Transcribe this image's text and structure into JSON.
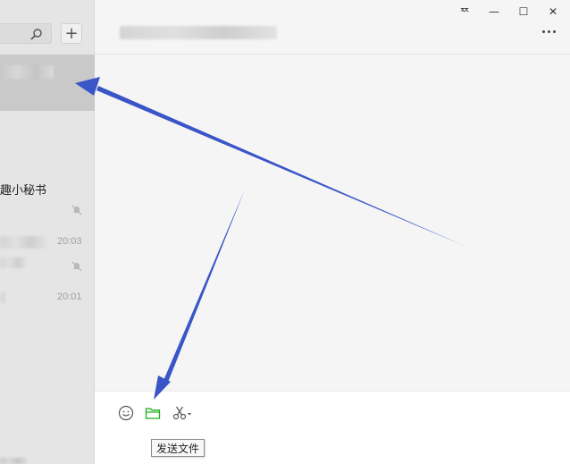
{
  "window": {
    "pin_label": "ᅑ",
    "minimize_label": "—",
    "maximize_label": "☐",
    "close_label": "✕"
  },
  "sidebar": {
    "add_label": "+",
    "chats": [
      {
        "name": "",
        "time": "",
        "muted": false
      },
      {
        "name": "趣小秘书",
        "time": "",
        "muted": true
      },
      {
        "name": "",
        "time": "20:03",
        "muted": true
      },
      {
        "name": "",
        "time": "20:01",
        "muted": false
      }
    ]
  },
  "input_toolbar": {
    "tooltip": "发送文件"
  },
  "colors": {
    "arrow": "#3a55c8",
    "folder_icon": "#1aad19",
    "selected_chat": "#c9c9c9",
    "sidebar_bg": "#e6e5e5"
  }
}
